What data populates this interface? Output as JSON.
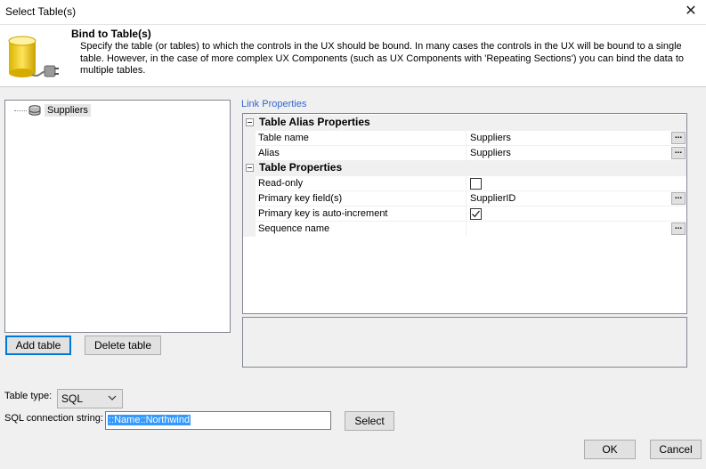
{
  "window": {
    "title": "Select Table(s)"
  },
  "header": {
    "title": "Bind to Table(s)",
    "description": "Specify the table (or tables) to which the controls in the UX should be bound. In many cases the controls in the UX will be bound to a single table. However, in the case of more complex UX Components (such as UX Components with 'Repeating Sections') you can bind the data to multiple tables."
  },
  "tree": {
    "items": [
      {
        "label": "Suppliers",
        "icon": "table-icon"
      }
    ]
  },
  "buttons": {
    "add_table": "Add table",
    "delete_table": "Delete table",
    "select": "Select",
    "ok": "OK",
    "cancel": "Cancel"
  },
  "link_properties": {
    "label": "Link Properties",
    "categories": [
      {
        "name": "Table Alias Properties",
        "rows": [
          {
            "name": "Table name",
            "value": "Suppliers",
            "editor": "ellipsis"
          },
          {
            "name": "Alias",
            "value": "Suppliers",
            "editor": "ellipsis"
          }
        ]
      },
      {
        "name": "Table Properties",
        "rows": [
          {
            "name": "Read-only",
            "checked": false,
            "editor": "checkbox"
          },
          {
            "name": "Primary key field(s)",
            "value": "SupplierID",
            "editor": "ellipsis"
          },
          {
            "name": "Primary key is auto-increment",
            "checked": true,
            "editor": "checkbox"
          },
          {
            "name": "Sequence name",
            "value": "",
            "editor": "ellipsis"
          }
        ]
      }
    ]
  },
  "table_type": {
    "label": "Table type:",
    "value": "SQL"
  },
  "connection": {
    "label": "SQL connection string:",
    "value": "::Name::Northwind"
  },
  "colors": {
    "accent": "#0078d7",
    "selection": "#3399ff",
    "link_label": "#3366cc"
  }
}
